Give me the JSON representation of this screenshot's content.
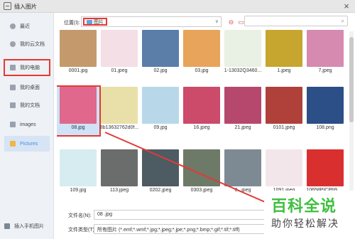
{
  "window": {
    "title": "插入图片"
  },
  "sidebar": {
    "items": [
      {
        "label": "最近"
      },
      {
        "label": "我的云文档"
      },
      {
        "label": "我的电脑"
      },
      {
        "label": "我的桌面"
      },
      {
        "label": "我的文档"
      },
      {
        "label": "images"
      },
      {
        "label": "Pictures"
      }
    ],
    "bottom_label": "插入手机图片"
  },
  "toolbar": {
    "location_label": "位置(I):",
    "location_value": "图片",
    "search_placeholder": ""
  },
  "files": [
    {
      "name": "0001.jpg",
      "color": "#c49a6c"
    },
    {
      "name": "01.jpeg",
      "color": "#f3dfe5"
    },
    {
      "name": "02.jpg",
      "color": "#5a7ea8"
    },
    {
      "name": "03.jpg",
      "color": "#e7a45a"
    },
    {
      "name": "1-13032Q3460...",
      "color": "#e9f0e4"
    },
    {
      "name": "1.jpeg",
      "color": "#c6a62e"
    },
    {
      "name": "7.jpeg",
      "color": "#d68ab0"
    },
    {
      "name": "08.jpg",
      "color": "#e0688d"
    },
    {
      "name": "8b13632762d0f...",
      "color": "#e8e0a8"
    },
    {
      "name": "09.jpg",
      "color": "#b8d8ea"
    },
    {
      "name": "16.jpeg",
      "color": "#cc4a6a"
    },
    {
      "name": "21.jpeg",
      "color": "#b6486e"
    },
    {
      "name": "0101.jpeg",
      "color": "#b0403a"
    },
    {
      "name": "108.png",
      "color": "#2b4f86"
    },
    {
      "name": "109.jpg",
      "color": "#d6ecf0"
    },
    {
      "name": "113.jpeg",
      "color": "#6a6d6c"
    },
    {
      "name": "0202.jpeg",
      "color": "#4d5b63"
    },
    {
      "name": "0303.jpeg",
      "color": "#6d7a68"
    },
    {
      "name": "0...jpeg",
      "color": "#7e8a93"
    },
    {
      "name": "1091.jpeg",
      "color": "#f2e6ea"
    },
    {
      "name": "10658PICPb9_...",
      "color": "#d9302f"
    }
  ],
  "bottom": {
    "filename_label": "文件名(N):",
    "filename_value": "08 .jpg",
    "filetype_label": "文件类型(T):",
    "filetype_value": "所有图片 (*.emf;*.wmf;*.jpg;*.jpeg;*.jpe;*.png;*.bmp;*.gif;*.tif;*.tiff)"
  },
  "watermark": {
    "big": "百科全说",
    "small": "助你轻松解决"
  }
}
